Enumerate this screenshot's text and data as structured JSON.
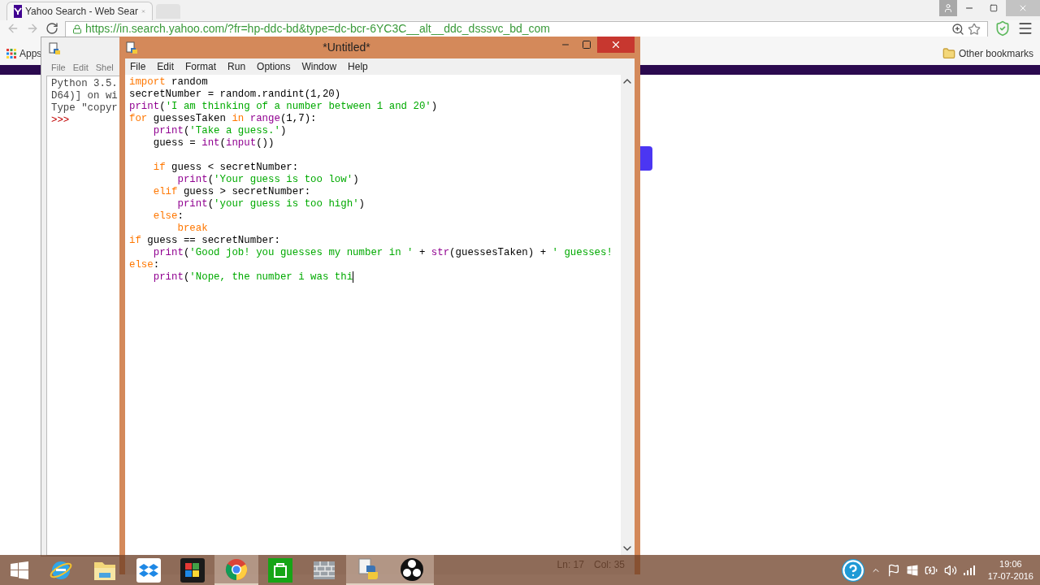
{
  "browser": {
    "tab": {
      "title": "Yahoo Search - Web Sear",
      "selected": true
    },
    "url": "https://in.search.yahoo.com/?fr=hp-ddc-bd&type=dc-bcr-6YC3C__alt__ddc_dsssvc_bd_com",
    "bookmarks": [
      "Apps"
    ],
    "other_bookmarks": "Other bookmarks"
  },
  "shell": {
    "menu": [
      "File",
      "Edit",
      "Shel"
    ],
    "lines": [
      "Python 3.5.",
      "D64)] on wi",
      "Type \"copyr",
      ">>>"
    ]
  },
  "editor": {
    "title": "*Untitled*",
    "menu": [
      "File",
      "Edit",
      "Format",
      "Run",
      "Options",
      "Window",
      "Help"
    ],
    "lines": [
      {
        "tokens": [
          {
            "kind": "keyword",
            "text": "import"
          },
          {
            "kind": "plain",
            "text": " random"
          }
        ]
      },
      {
        "tokens": [
          {
            "kind": "plain",
            "text": "secretNumber = random.randint(1,20)"
          }
        ]
      },
      {
        "tokens": [
          {
            "kind": "builtin",
            "text": "print"
          },
          {
            "kind": "plain",
            "text": "("
          },
          {
            "kind": "string",
            "text": "'I am thinking of a number between 1 and 20'"
          },
          {
            "kind": "plain",
            "text": ")"
          }
        ]
      },
      {
        "tokens": [
          {
            "kind": "keyword",
            "text": "for"
          },
          {
            "kind": "plain",
            "text": " guessesTaken "
          },
          {
            "kind": "keyword",
            "text": "in"
          },
          {
            "kind": "builtin",
            "text": " range"
          },
          {
            "kind": "plain",
            "text": "(1,7):"
          }
        ]
      },
      {
        "tokens": [
          {
            "kind": "builtin",
            "text": "    print"
          },
          {
            "kind": "plain",
            "text": "("
          },
          {
            "kind": "string",
            "text": "'Take a guess.'"
          },
          {
            "kind": "plain",
            "text": ")"
          }
        ]
      },
      {
        "tokens": [
          {
            "kind": "plain",
            "text": "    guess = "
          },
          {
            "kind": "builtin",
            "text": "int"
          },
          {
            "kind": "plain",
            "text": "("
          },
          {
            "kind": "builtin",
            "text": "input"
          },
          {
            "kind": "plain",
            "text": "())"
          }
        ]
      },
      {
        "blank_before": true,
        "tokens": [
          {
            "kind": "keyword",
            "text": "    if"
          },
          {
            "kind": "plain",
            "text": " guess < secretNumber:"
          }
        ]
      },
      {
        "tokens": [
          {
            "kind": "builtin",
            "text": "        print"
          },
          {
            "kind": "plain",
            "text": "("
          },
          {
            "kind": "string",
            "text": "'Your guess is too low'"
          },
          {
            "kind": "plain",
            "text": ")"
          }
        ]
      },
      {
        "tokens": [
          {
            "kind": "keyword",
            "text": "    elif"
          },
          {
            "kind": "plain",
            "text": " guess > secretNumber:"
          }
        ]
      },
      {
        "tokens": [
          {
            "kind": "builtin",
            "text": "        print"
          },
          {
            "kind": "plain",
            "text": "("
          },
          {
            "kind": "string",
            "text": "'your guess is too high'"
          },
          {
            "kind": "plain",
            "text": ")"
          }
        ]
      },
      {
        "tokens": [
          {
            "kind": "keyword",
            "text": "    else"
          },
          {
            "kind": "plain",
            "text": ":"
          }
        ]
      },
      {
        "tokens": [
          {
            "kind": "keyword",
            "text": "        break"
          }
        ]
      },
      {
        "tokens": [
          {
            "kind": "keyword",
            "text": "if"
          },
          {
            "kind": "plain",
            "text": " guess == secretNumber:"
          }
        ]
      },
      {
        "tokens": [
          {
            "kind": "builtin",
            "text": "    print"
          },
          {
            "kind": "plain",
            "text": "("
          },
          {
            "kind": "string",
            "text": "'Good job! you guesses my number in '"
          },
          {
            "kind": "plain",
            "text": " + "
          },
          {
            "kind": "builtin",
            "text": "str"
          },
          {
            "kind": "plain",
            "text": "(guessesTaken) + "
          },
          {
            "kind": "string",
            "text": "' guesses!"
          }
        ]
      },
      {
        "tokens": [
          {
            "kind": "keyword",
            "text": "else"
          },
          {
            "kind": "plain",
            "text": ":"
          }
        ]
      },
      {
        "tokens": [
          {
            "kind": "builtin",
            "text": "    print"
          },
          {
            "kind": "plain",
            "text": "("
          },
          {
            "kind": "string",
            "text": "'Nope, the number i was thi"
          }
        ]
      }
    ],
    "status": {
      "line": "Ln: 17",
      "col": "Col: 35"
    }
  },
  "taskbar": {
    "apps": [
      {
        "kind": "ie",
        "running": false
      },
      {
        "kind": "explorer",
        "running": false
      },
      {
        "kind": "dropbox",
        "running": false
      },
      {
        "kind": "puzzle",
        "running": false
      },
      {
        "kind": "chrome",
        "running": true
      },
      {
        "kind": "store",
        "running": false
      },
      {
        "kind": "wall",
        "running": false
      },
      {
        "kind": "python",
        "running": true
      },
      {
        "kind": "obs",
        "running": true
      }
    ],
    "clock": {
      "time": "19:06",
      "date": "17-07-2016"
    }
  }
}
